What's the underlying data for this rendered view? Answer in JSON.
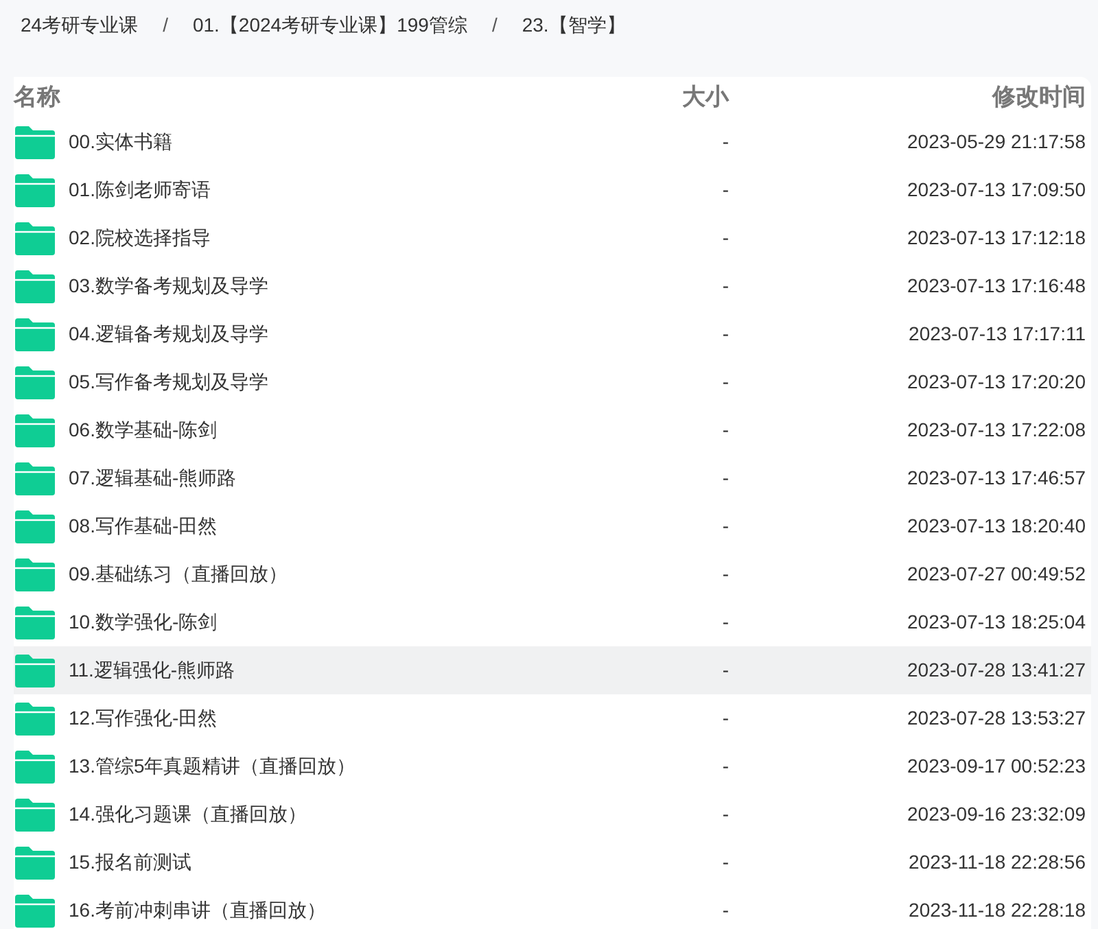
{
  "breadcrumb": [
    "24考研专业课",
    "01.【2024考研专业课】199管综",
    "23.【智学】"
  ],
  "breadcrumb_separators": [
    "/",
    "/"
  ],
  "columns": [
    "名称",
    "大小",
    "修改时间"
  ],
  "rows": [
    {
      "name": "00.实体书籍",
      "size": "-",
      "modified": "2023-05-29 21:17:58",
      "selected": false
    },
    {
      "name": "01.陈剑老师寄语",
      "size": "-",
      "modified": "2023-07-13 17:09:50",
      "selected": false
    },
    {
      "name": "02.院校选择指导",
      "size": "-",
      "modified": "2023-07-13 17:12:18",
      "selected": false
    },
    {
      "name": "03.数学备考规划及导学",
      "size": "-",
      "modified": "2023-07-13 17:16:48",
      "selected": false
    },
    {
      "name": "04.逻辑备考规划及导学",
      "size": "-",
      "modified": "2023-07-13 17:17:11",
      "selected": false
    },
    {
      "name": "05.写作备考规划及导学",
      "size": "-",
      "modified": "2023-07-13 17:20:20",
      "selected": false
    },
    {
      "name": "06.数学基础-陈剑",
      "size": "-",
      "modified": "2023-07-13 17:22:08",
      "selected": false
    },
    {
      "name": "07.逻辑基础-熊师路",
      "size": "-",
      "modified": "2023-07-13 17:46:57",
      "selected": false
    },
    {
      "name": "08.写作基础-田然",
      "size": "-",
      "modified": "2023-07-13 18:20:40",
      "selected": false
    },
    {
      "name": "09.基础练习（直播回放）",
      "size": "-",
      "modified": "2023-07-27 00:49:52",
      "selected": false
    },
    {
      "name": "10.数学强化-陈剑",
      "size": "-",
      "modified": "2023-07-13 18:25:04",
      "selected": false
    },
    {
      "name": "11.逻辑强化-熊师路",
      "size": "-",
      "modified": "2023-07-28 13:41:27",
      "selected": true
    },
    {
      "name": "12.写作强化-田然",
      "size": "-",
      "modified": "2023-07-28 13:53:27",
      "selected": false
    },
    {
      "name": "13.管综5年真题精讲（直播回放）",
      "size": "-",
      "modified": "2023-09-17 00:52:23",
      "selected": false
    },
    {
      "name": "14.强化习题课（直播回放）",
      "size": "-",
      "modified": "2023-09-16 23:32:09",
      "selected": false
    },
    {
      "name": "15.报名前测试",
      "size": "-",
      "modified": "2023-11-18 22:28:56",
      "selected": false
    },
    {
      "name": "16.考前冲刺串讲（直播回放）",
      "size": "-",
      "modified": "2023-11-18 22:28:18",
      "selected": false
    }
  ]
}
